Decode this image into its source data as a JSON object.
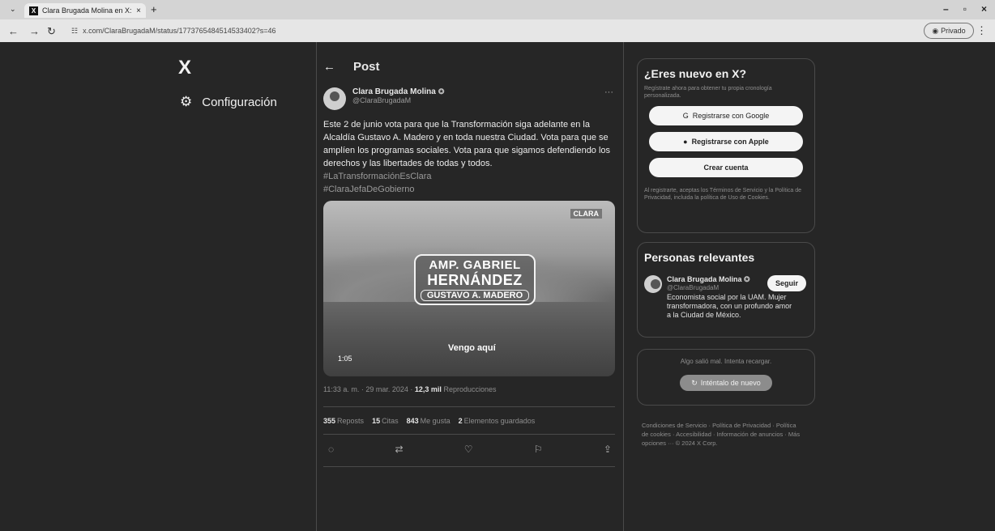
{
  "browser": {
    "tab_title": "Clara Brugada Molina en X: \"E",
    "url": "x.com/ClaraBrugadaM/status/1773765484514533402?s=46",
    "incognito_label": "Privado"
  },
  "left_nav": {
    "logo": "X",
    "settings_label": "Configuración"
  },
  "post": {
    "header_title": "Post",
    "author_name": "Clara Brugada Molina",
    "author_handle": "@ClaraBrugadaM",
    "text": "Este 2 de junio vota para que la Transformación siga adelante en la Alcaldía Gustavo A. Madero y en toda nuestra Ciudad. Vota para que se amplíen los programas sociales. Vota para que sigamos defendiendo los derechos y las libertades de todas y todos.",
    "hashtags": [
      "#LaTransformaciónEsClara",
      "#ClaraJefaDeGobierno"
    ],
    "media": {
      "brand": "CLARA",
      "badge_line1": "AMP. GABRIEL",
      "badge_line2": "HERNÁNDEZ",
      "badge_line3": "GUSTAVO A. MADERO",
      "caption": "Vengo aquí",
      "duration": "1:05"
    },
    "timestamp": "11:33 a. m. · 29 mar. 2024 · ",
    "views_count": "12,3 mil",
    "views_label": " Reproducciones",
    "stats": [
      {
        "count": "355",
        "label": "Reposts"
      },
      {
        "count": "15",
        "label": "Citas"
      },
      {
        "count": "843",
        "label": "Me gusta"
      },
      {
        "count": "2",
        "label": "Elementos guardados"
      }
    ],
    "actions": [
      "reply-icon",
      "repost-icon",
      "like-icon",
      "bookmark-icon",
      "share-icon"
    ]
  },
  "signup": {
    "title": "¿Eres nuevo en X?",
    "subtitle": "Regístrate ahora para obtener tu propia cronología personalizada.",
    "google_label": "Registrarse con Google",
    "apple_label": "Registrarse con Apple",
    "create_label": "Crear cuenta",
    "legal": "Al registrarte, aceptas los Términos de Servicio y la Política de Privacidad, incluida la política de Uso de Cookies."
  },
  "people": {
    "title": "Personas relevantes",
    "name": "Clara Brugada Molina",
    "handle": "@ClaraBrugadaM",
    "follow_label": "Seguir",
    "bio": "Economista social por la UAM. Mujer transformadora, con un profundo amor a la Ciudad de México."
  },
  "error_card": {
    "text": "Algo salió mal. Intenta recargar.",
    "retry_label": "Inténtalo de nuevo"
  },
  "footer": {
    "text": "Condiciones de Servicio · Política de Privacidad · Política de cookies · Accesibilidad · Información de anuncios · Más opciones ··· © 2024 X Corp."
  }
}
